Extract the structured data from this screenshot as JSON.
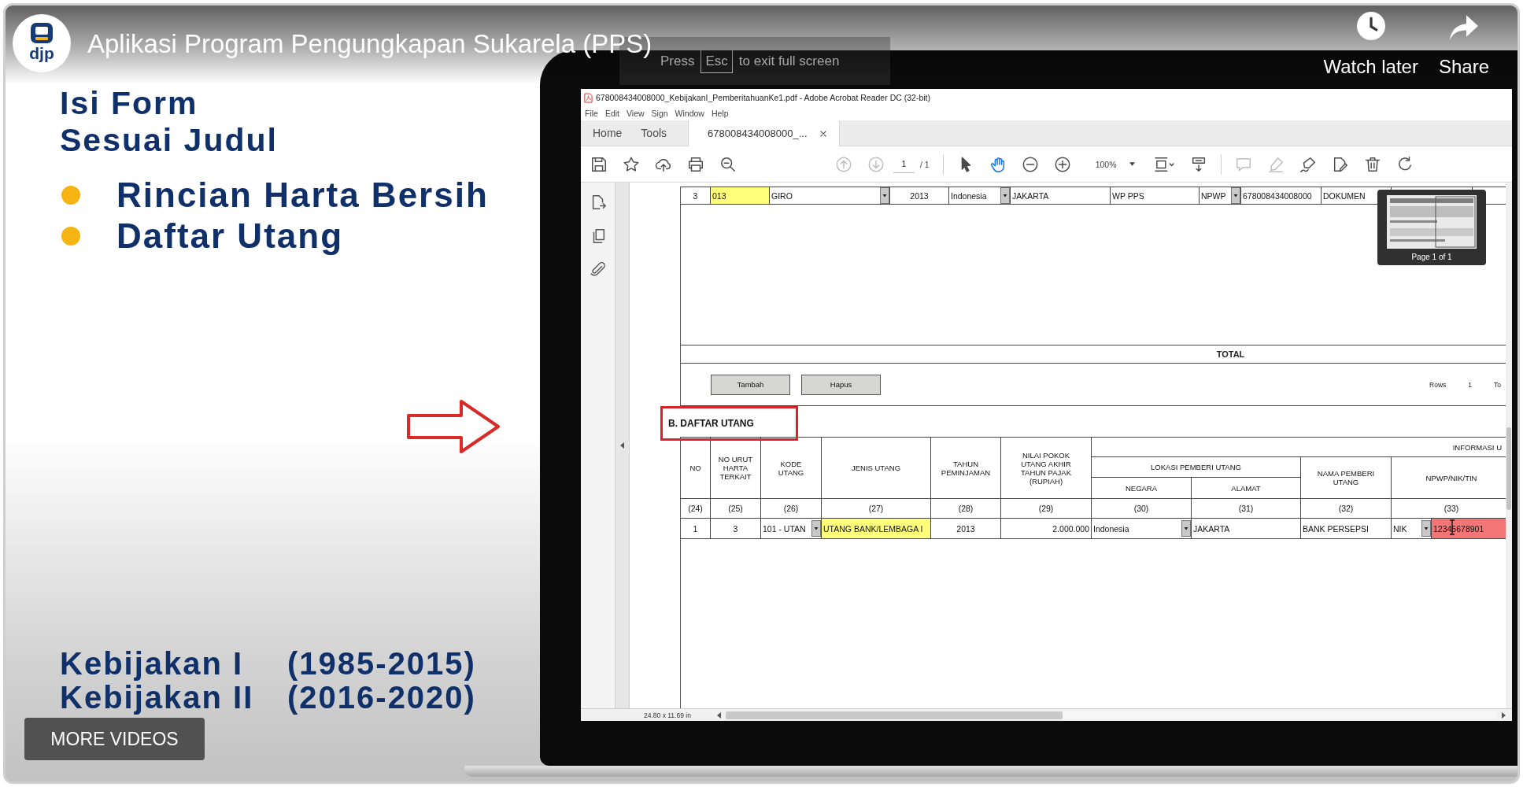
{
  "video": {
    "channel_logo": "djp",
    "title": "Aplikasi Program Pengungkapan Sukarela (PPS)",
    "fullscreen_hint": {
      "before": "Press",
      "key": "Esc",
      "after": "to exit full screen"
    },
    "actions": [
      {
        "kind": "watch_later",
        "label": "Watch later"
      },
      {
        "kind": "share",
        "label": "Share"
      }
    ],
    "more_videos": "MORE VIDEOS"
  },
  "slide": {
    "heading": [
      "Isi Form",
      "Sesuai Judul"
    ],
    "bullets": [
      "Rincian Harta Bersih",
      "Daftar Utang"
    ],
    "periods": [
      {
        "label": "Kebijakan I",
        "years": "(1985-2015)"
      },
      {
        "label": "Kebijakan II",
        "years": "(2016-2020)"
      }
    ]
  },
  "acrobat": {
    "window_title": "678008434008000_KebijakanI_PemberitahuanKe1.pdf - Adobe Acrobat Reader DC (32-bit)",
    "menu": [
      "File",
      "Edit",
      "View",
      "Sign",
      "Window",
      "Help"
    ],
    "tabs": [
      {
        "label": "Home",
        "selected": false,
        "closable": false
      },
      {
        "label": "Tools",
        "selected": false,
        "closable": false
      },
      {
        "label": "678008434008000_...",
        "selected": true,
        "closable": true
      }
    ],
    "toolbar": {
      "groups": [
        {
          "tools": [
            {
              "kind": "save",
              "disabled": false,
              "selected": false
            },
            {
              "kind": "bookmark",
              "disabled": false,
              "selected": false
            },
            {
              "kind": "upload",
              "disabled": false,
              "selected": false
            },
            {
              "kind": "print",
              "disabled": false,
              "selected": false
            },
            {
              "kind": "find",
              "disabled": false,
              "selected": false
            }
          ]
        },
        {
          "tools": [
            {
              "kind": "previous",
              "disabled": true,
              "selected": false
            },
            {
              "kind": "next",
              "disabled": true,
              "selected": false
            },
            {
              "kind": "page",
              "value": "1",
              "total": "/ 1",
              "disabled": false,
              "selected": false
            }
          ]
        },
        {
          "tools": [
            {
              "kind": "select",
              "disabled": false,
              "selected": false
            },
            {
              "kind": "hand",
              "disabled": false,
              "selected": true
            },
            {
              "kind": "zoom_out",
              "disabled": false,
              "selected": false
            },
            {
              "kind": "zoom_in",
              "disabled": false,
              "selected": false
            },
            {
              "kind": "zoom",
              "value": "100%",
              "disabled": false,
              "selected": false
            },
            {
              "kind": "fit",
              "disabled": false,
              "selected": false
            },
            {
              "kind": "scroll",
              "disabled": false,
              "selected": false
            }
          ]
        },
        {
          "tools": [
            {
              "kind": "comment",
              "disabled": true,
              "selected": false
            },
            {
              "kind": "highlight",
              "disabled": true,
              "selected": false
            },
            {
              "kind": "sign",
              "disabled": false,
              "selected": false
            },
            {
              "kind": "fill",
              "disabled": false,
              "selected": false
            },
            {
              "kind": "delete",
              "disabled": false,
              "selected": false
            },
            {
              "kind": "rotate",
              "disabled": false,
              "selected": false
            }
          ]
        }
      ]
    },
    "document": {
      "asset_row": [
        {
          "kind": "center",
          "text": "3"
        },
        {
          "kind": "highlight",
          "text": "013"
        },
        {
          "kind": "dropdown",
          "text": "GIRO"
        },
        {
          "kind": "center",
          "text": "2013"
        },
        {
          "kind": "dropdown",
          "text": "Indonesia"
        },
        {
          "kind": "text",
          "text": "JAKARTA"
        },
        {
          "kind": "text",
          "text": "WP PPS"
        },
        {
          "kind": "dropdown",
          "text": "NPWP"
        },
        {
          "kind": "text",
          "text": "678008434008000"
        },
        {
          "kind": "text",
          "text": "DOKUMEN"
        }
      ],
      "thumbnail": "Page 1 of 1",
      "total_label": "TOTAL",
      "buttons": [
        "Tambah",
        "Hapus"
      ],
      "rows_info": [
        "Rows",
        "1",
        "To"
      ],
      "debt_section": {
        "title": "B. DAFTAR UTANG",
        "columns": [
          {
            "label": "NO"
          },
          {
            "label": "NO URUT HARTA TERKAIT"
          },
          {
            "label": "KODE UTANG"
          },
          {
            "label": "JENIS UTANG"
          },
          {
            "label": "TAHUN PEMINJAMAN"
          },
          {
            "label": "NILAI POKOK UTANG AKHIR TAHUN PAJAK (RUPIAH)"
          },
          {
            "label": "INFORMASI U",
            "children": [
              {
                "label": "LOKASI PEMBERI UTANG",
                "children": [
                  {
                    "label": "NEGARA"
                  },
                  {
                    "label": "ALAMAT"
                  }
                ]
              },
              {
                "label": "NAMA PEMBERI UTANG"
              },
              {
                "label": "NPWP/NIK/TIN"
              }
            ]
          }
        ],
        "column_numbers": [
          "(24)",
          "(25)",
          "(26)",
          "(27)",
          "(28)",
          "(29)",
          "(30)",
          "(31)",
          "(32)",
          "(33)"
        ],
        "rows": [
          [
            {
              "kind": "center",
              "text": "1"
            },
            {
              "kind": "center",
              "text": "3"
            },
            {
              "kind": "dropdown",
              "text": "101 - UTAN"
            },
            {
              "kind": "highlight",
              "text": "UTANG BANK/LEMBAGA I"
            },
            {
              "kind": "center",
              "text": "2013"
            },
            {
              "kind": "amount",
              "text": "2.000.000"
            },
            {
              "kind": "dropdown",
              "text": "Indonesia"
            },
            {
              "kind": "text",
              "text": "JAKARTA"
            },
            {
              "kind": "text",
              "text": "BANK PERSEPSI"
            },
            {
              "kind": "dropdown",
              "text": "NIK"
            },
            {
              "kind": "error",
              "text": "12345678901"
            }
          ]
        ]
      }
    },
    "status": {
      "page_size": "24.80 x 11.69 in"
    }
  }
}
